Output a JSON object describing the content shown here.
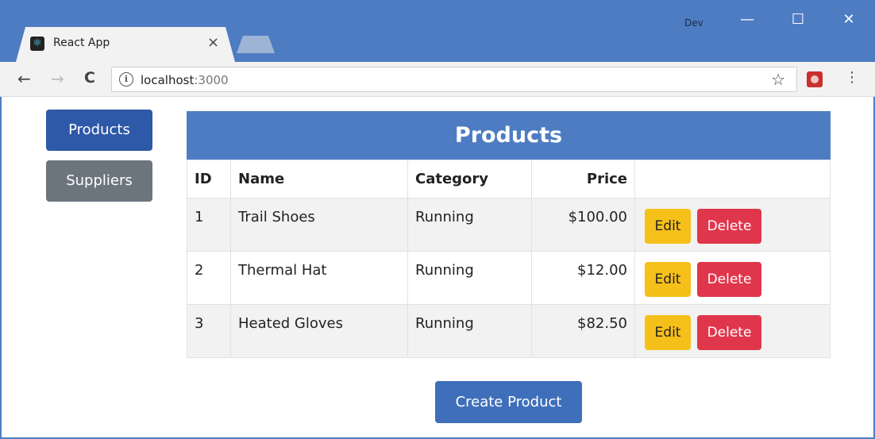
{
  "browser": {
    "tab_title": "React App",
    "tab_close": "×",
    "profile_name": "Dev",
    "window_controls": {
      "minimize": "—",
      "maximize": "☐",
      "close": "✕"
    },
    "nav": {
      "back": "←",
      "forward": "→",
      "reload": "C"
    },
    "address": {
      "host": "localhost",
      "port": ":3000"
    },
    "icons": {
      "info": "info-icon",
      "star": "star-icon",
      "extension": "extension-icon",
      "menu": "kebab-menu-icon"
    },
    "accent_color": "#4e7cc2"
  },
  "sidebar": {
    "items": [
      {
        "label": "Products",
        "active": true
      },
      {
        "label": "Suppliers",
        "active": false
      }
    ]
  },
  "products": {
    "title": "Products",
    "columns": [
      "ID",
      "Name",
      "Category",
      "Price"
    ],
    "rows": [
      {
        "id": "1",
        "name": "Trail Shoes",
        "category": "Running",
        "price": "$100.00"
      },
      {
        "id": "2",
        "name": "Thermal Hat",
        "category": "Running",
        "price": "$12.00"
      },
      {
        "id": "3",
        "name": "Heated Gloves",
        "category": "Running",
        "price": "$82.50"
      }
    ],
    "edit_label": "Edit",
    "delete_label": "Delete",
    "create_label": "Create Product"
  },
  "colors": {
    "primary": "#2e59a8",
    "secondary": "#6c757d",
    "warning": "#f6c01a",
    "danger": "#e0364c"
  }
}
